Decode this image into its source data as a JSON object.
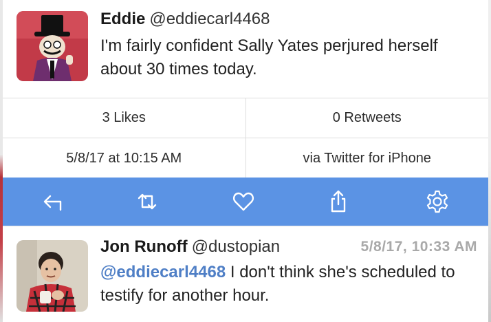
{
  "tweet": {
    "author_name": "Eddie",
    "author_handle": "@eddiecarl4468",
    "text": "I'm fairly confident Sally Yates perjured herself about 30 times today."
  },
  "stats": {
    "likes": "3 Likes",
    "retweets": "0 Retweets",
    "timestamp": "5/8/17 at 10:15 AM",
    "source": "via Twitter for iPhone"
  },
  "actions": [
    {
      "name": "reply",
      "icon": "reply-icon"
    },
    {
      "name": "retweet",
      "icon": "retweet-icon"
    },
    {
      "name": "like",
      "icon": "heart-icon"
    },
    {
      "name": "share",
      "icon": "share-icon"
    },
    {
      "name": "settings",
      "icon": "gear-icon"
    }
  ],
  "reply": {
    "author_name": "Jon Runoff",
    "author_handle": "@dustopian",
    "time": "5/8/17, 10:33 AM",
    "mention": "@eddiecarl4468",
    "text": " I don't think she's scheduled to testify for another hour."
  },
  "colors": {
    "action_bar": "#5b93e4",
    "mention": "#4f7fc6",
    "timestamp_gray": "#a9a9a9"
  }
}
